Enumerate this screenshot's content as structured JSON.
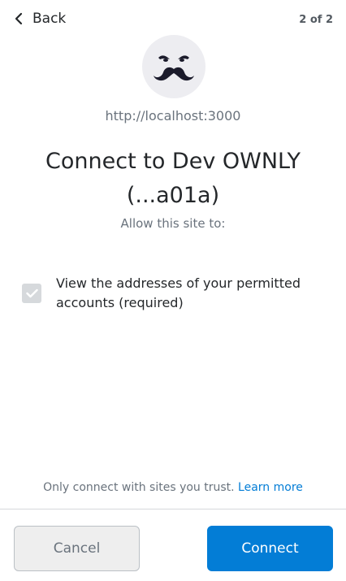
{
  "header": {
    "back_label": "Back",
    "step_label": "2 of 2"
  },
  "site": {
    "origin": "http://localhost:3000",
    "avatar_icon": "mustache-face-icon"
  },
  "connect": {
    "title": "Connect to Dev OWNLY (...a01a)",
    "subtitle": "Allow this site to:"
  },
  "permissions": [
    {
      "label": "View the addresses of your permitted accounts (required)",
      "checked": true,
      "disabled": true
    }
  ],
  "footer": {
    "trust_text": "Only connect with sites you trust.",
    "learn_more": "Learn more",
    "cancel_label": "Cancel",
    "connect_label": "Connect"
  },
  "colors": {
    "primary": "#037dd6",
    "text": "#24272a",
    "muted": "#6a737d",
    "border": "#d6d9dc"
  }
}
